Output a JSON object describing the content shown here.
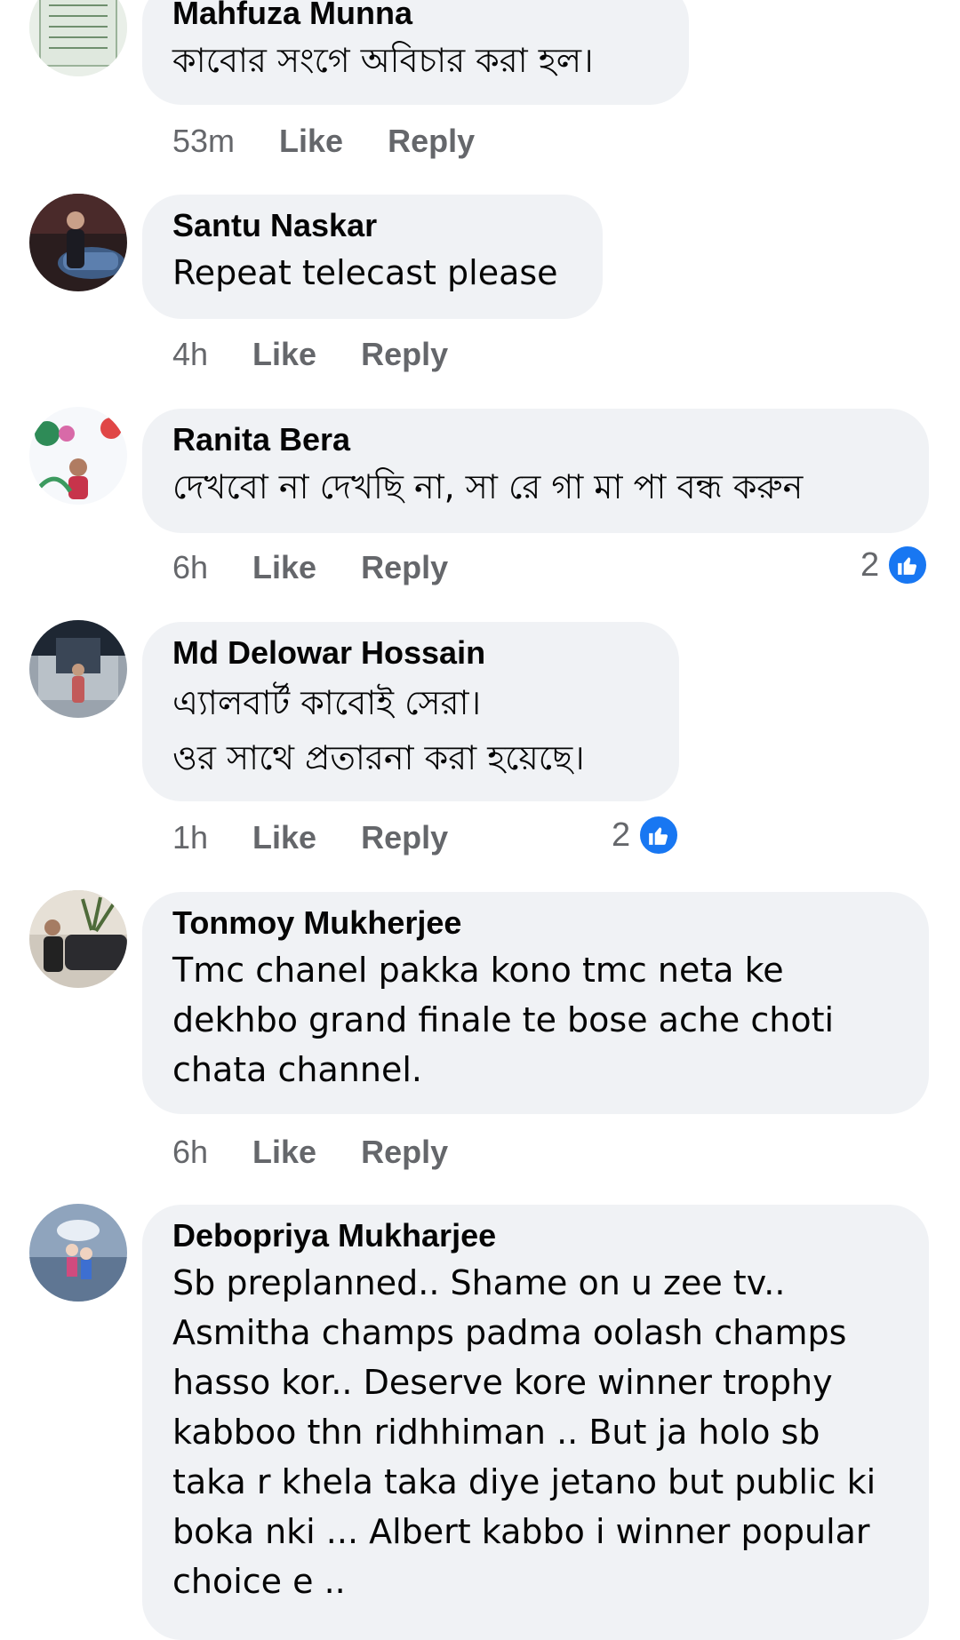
{
  "comments": [
    {
      "author": "Mahfuza Munna",
      "lines": [
        "কাবোর সংগে অবিচার করা হল।"
      ],
      "time": "53m",
      "like_label": "Like",
      "reply_label": "Reply",
      "reactions": ""
    },
    {
      "author": "Santu Naskar",
      "lines": [
        "Repeat telecast please"
      ],
      "time": "4h",
      "like_label": "Like",
      "reply_label": "Reply",
      "reactions": ""
    },
    {
      "author": "Ranita Bera",
      "lines": [
        "দেখবো না দেখছি না,  সা রে গা মা পা বন্ধ করুন"
      ],
      "time": "6h",
      "like_label": "Like",
      "reply_label": "Reply",
      "reactions": "2"
    },
    {
      "author": "Md Delowar Hossain",
      "lines": [
        "এ্যালবার্ট কাবোই সেরা।",
        "ওর সাথে প্রতারনা করা হয়েছে।"
      ],
      "time": "1h",
      "like_label": "Like",
      "reply_label": "Reply",
      "reactions": "2"
    },
    {
      "author": "Tonmoy Mukherjee",
      "lines": [
        "Tmc chanel pakka kono tmc neta ke",
        "dekhbo grand finale te bose ache choti",
        "chata channel."
      ],
      "time": "6h",
      "like_label": "Like",
      "reply_label": "Reply",
      "reactions": ""
    },
    {
      "author": "Debopriya Mukharjee",
      "lines": [
        "Sb preplanned.. Shame on u zee tv..",
        "Asmitha champs  padma oolash champs",
        "hasso kor.. Deserve kore winner trophy",
        "kabboo thn ridhhiman  .. But ja holo sb",
        "taka r khela taka diye jetano but public ki",
        "boka nki   ... Albert kabbo i winner popular",
        "choice e .."
      ],
      "time": "",
      "like_label": "",
      "reply_label": "",
      "reactions": ""
    }
  ],
  "colors": {
    "bubble": "#f0f2f5",
    "meta_text": "#65676b",
    "like_badge": "#1877f2"
  },
  "icons": {
    "like_reaction": "thumbs-up-icon"
  }
}
